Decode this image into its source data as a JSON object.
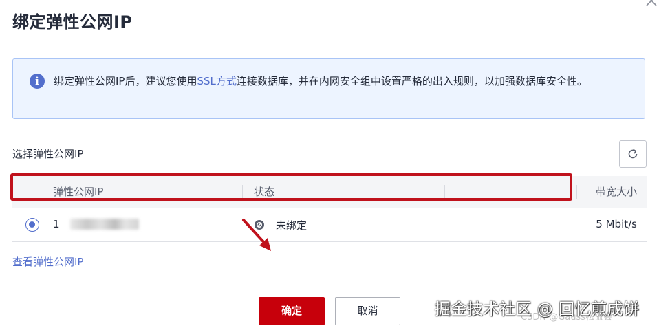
{
  "dialog": {
    "title": "绑定弹性公网IP",
    "close_icon": "close-icon"
  },
  "info": {
    "icon": "info-icon",
    "icon_glyph": "i",
    "text_before": "绑定弹性公网IP后，建议您使用",
    "link": "SSL方式",
    "text_after": "连接数据库，并在内网安全组中设置严格的出入规则，以加强数据库安全性。"
  },
  "select_label": "选择弹性公网IP",
  "refresh_icon": "refresh-icon",
  "table": {
    "headers": [
      "弹性公网IP",
      "状态",
      "带宽大小"
    ],
    "rows": [
      {
        "selected": true,
        "ip": "1",
        "status": "未绑定",
        "status_icon": "unbound-icon",
        "bandwidth": "5 Mbit/s"
      }
    ]
  },
  "view_link": "查看弹性公网IP",
  "buttons": {
    "ok": "确定",
    "cancel": "取消"
  },
  "watermark": {
    "main": "掘金技术社区 @ 回忆煎成饼",
    "sub": "CSDN @Gauss松鼠会"
  },
  "colors": {
    "primary": "#c7000b",
    "link": "#526ecc",
    "info_bg": "#edf4ff",
    "info_border": "#a9c4f6",
    "annotation": "#c0121c"
  }
}
